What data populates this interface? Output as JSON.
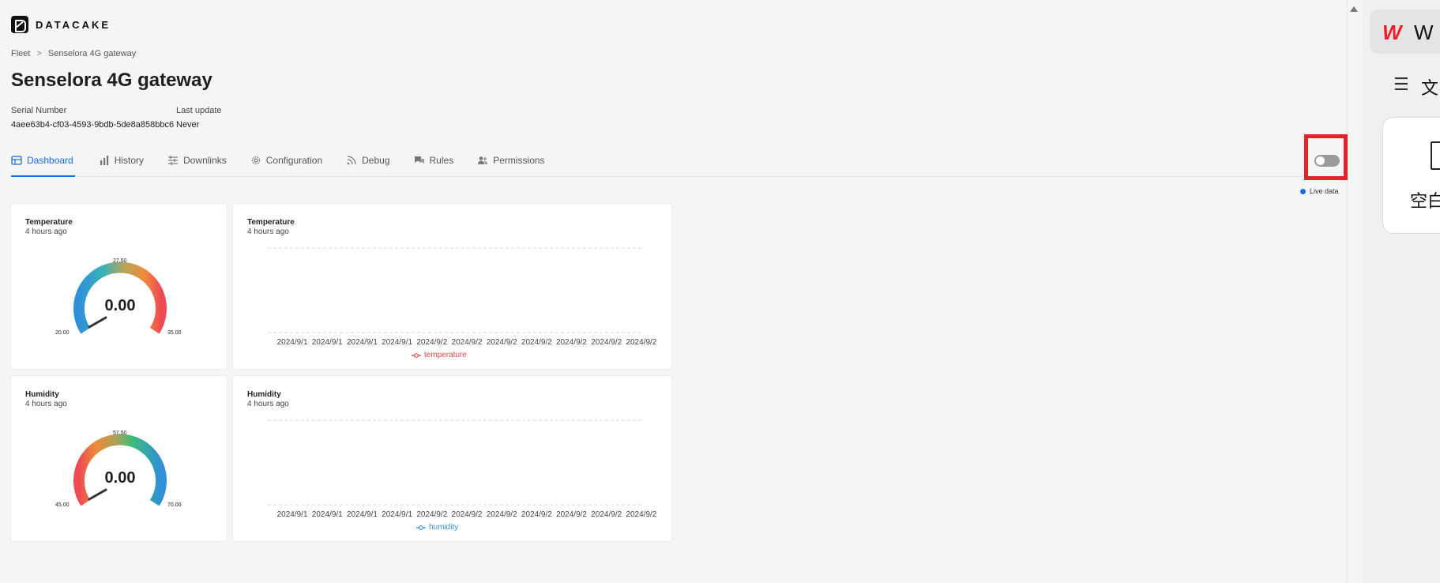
{
  "app": {
    "logo_text": "DATACAKE"
  },
  "breadcrumb": {
    "root": "Fleet",
    "separator": ">",
    "current": "Senselora 4G gateway"
  },
  "page": {
    "title": "Senselora 4G gateway"
  },
  "meta": {
    "serial_label": "Serial Number",
    "serial_value": "4aee63b4-cf03-4593-9bdb-5de8a858bbc6",
    "last_update_label": "Last update",
    "last_update_value": "Never"
  },
  "tabs": [
    {
      "label": "Dashboard",
      "icon": "table-icon",
      "active": true
    },
    {
      "label": "History",
      "icon": "bar-chart-icon"
    },
    {
      "label": "Downlinks",
      "icon": "sliders-icon"
    },
    {
      "label": "Configuration",
      "icon": "gear-icon"
    },
    {
      "label": "Debug",
      "icon": "rss-icon"
    },
    {
      "label": "Rules",
      "icon": "chat-icon"
    },
    {
      "label": "Permissions",
      "icon": "users-icon"
    }
  ],
  "live": {
    "label": "Live data",
    "toggle_on": false,
    "toggle_icon": "code-icon"
  },
  "widgets": {
    "temp_gauge": {
      "title": "Temperature",
      "subtitle": "4 hours ago",
      "value": "0.00",
      "min": "20.00",
      "mid": "27.50",
      "max": "35.00"
    },
    "temp_chart": {
      "title": "Temperature",
      "subtitle": "4 hours ago",
      "legend": "temperature",
      "legend_color": "#e8474d"
    },
    "hum_gauge": {
      "title": "Humidity",
      "subtitle": "4 hours ago",
      "value": "0.00",
      "min": "45.00",
      "mid": "57.50",
      "max": "70.00"
    },
    "hum_chart": {
      "title": "Humidity",
      "subtitle": "4 hours ago",
      "legend": "humidity",
      "legend_color": "#3a8fd6"
    }
  },
  "chart_data": [
    {
      "type": "line",
      "categories": [
        "2024/9/1",
        "2024/9/1",
        "2024/9/1",
        "2024/9/1",
        "2024/9/2",
        "2024/9/2",
        "2024/9/2",
        "2024/9/2",
        "2024/9/2",
        "2024/9/2",
        "2024/9/2"
      ],
      "series": [
        {
          "name": "temperature",
          "values": []
        }
      ],
      "title": "Temperature",
      "grid": true,
      "legend": "bottom-center"
    },
    {
      "type": "line",
      "categories": [
        "2024/9/1",
        "2024/9/1",
        "2024/9/1",
        "2024/9/1",
        "2024/9/2",
        "2024/9/2",
        "2024/9/2",
        "2024/9/2",
        "2024/9/2",
        "2024/9/2",
        "2024/9/2"
      ],
      "series": [
        {
          "name": "humidity",
          "values": []
        }
      ],
      "title": "Humidity",
      "grid": true,
      "legend": "bottom-center"
    }
  ],
  "side_panel": {
    "brand_letter": "W",
    "menu_icon": "menu-icon",
    "menu_text": "文",
    "card_label": "空白"
  }
}
